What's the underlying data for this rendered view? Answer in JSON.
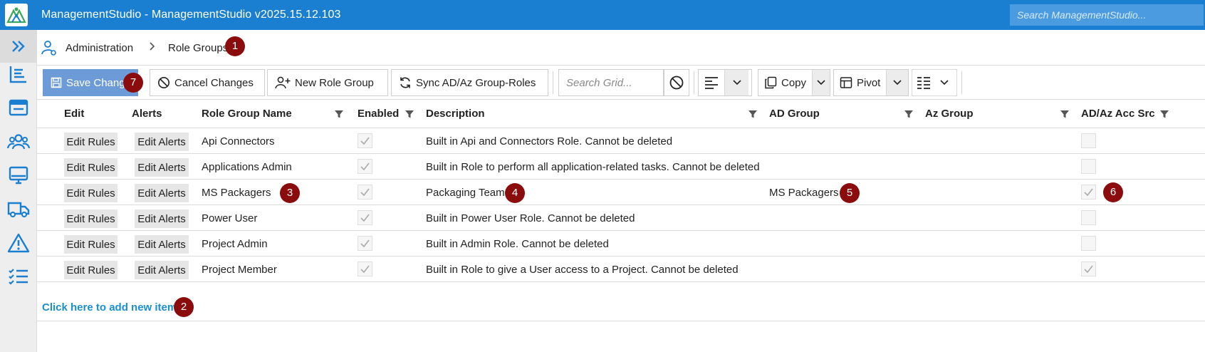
{
  "window": {
    "title": "ManagementStudio - ManagementStudio v2025.15.12.103",
    "search_placeholder": "Search ManagementStudio..."
  },
  "breadcrumb": {
    "items": [
      "Administration",
      "Role Groups"
    ]
  },
  "badges": [
    "1",
    "2",
    "3",
    "4",
    "5",
    "6",
    "7"
  ],
  "toolbar": {
    "save_label": "Save Changes",
    "cancel_label": "Cancel Changes",
    "new_label": "New Role Group",
    "sync_label": "Sync AD/Az Group-Roles",
    "grid_search_placeholder": "Search Grid...",
    "copy_label": "Copy",
    "pivot_label": "Pivot"
  },
  "grid": {
    "columns": [
      "Edit",
      "Alerts",
      "Role Group Name",
      "Enabled",
      "Description",
      "AD Group",
      "Az Group",
      "AD/Az Acc Src"
    ],
    "edit_label": "Edit Rules",
    "alerts_label": "Edit Alerts",
    "rows": [
      {
        "name": "Api Connectors",
        "enabled": true,
        "description": "Built in Api and Connectors Role. Cannot be deleted",
        "ad_group": "",
        "az_group": "",
        "acc_src": false
      },
      {
        "name": "Applications Admin",
        "enabled": true,
        "description": "Built in Role to perform all application-related tasks. Cannot be deleted",
        "ad_group": "",
        "az_group": "",
        "acc_src": false
      },
      {
        "name": "MS Packagers",
        "enabled": true,
        "description": "Packaging Team",
        "ad_group": "MS Packagers",
        "az_group": "",
        "acc_src": true
      },
      {
        "name": "Power User",
        "enabled": true,
        "description": "Built in Power User Role. Cannot be deleted",
        "ad_group": "",
        "az_group": "",
        "acc_src": false
      },
      {
        "name": "Project Admin",
        "enabled": true,
        "description": "Built in Admin Role. Cannot be deleted",
        "ad_group": "",
        "az_group": "",
        "acc_src": false
      },
      {
        "name": "Project Member",
        "enabled": true,
        "description": "Built in Role to give a User access to a Project. Cannot be deleted",
        "ad_group": "",
        "az_group": "",
        "acc_src": true
      }
    ],
    "add_new_label": "Click here to add new item"
  },
  "colors": {
    "titlebar": "#1a7fd0",
    "badge": "#8b0c0c",
    "primary_button": "#6d9bd8",
    "link": "#1a8fd0",
    "nav_icon": "#1a7fd0"
  },
  "icons": {
    "nav": [
      "expand-icon",
      "list-icon",
      "applications-icon",
      "users-icon",
      "computer-icon",
      "delivery-icon",
      "warning-icon",
      "tasks-icon"
    ]
  }
}
